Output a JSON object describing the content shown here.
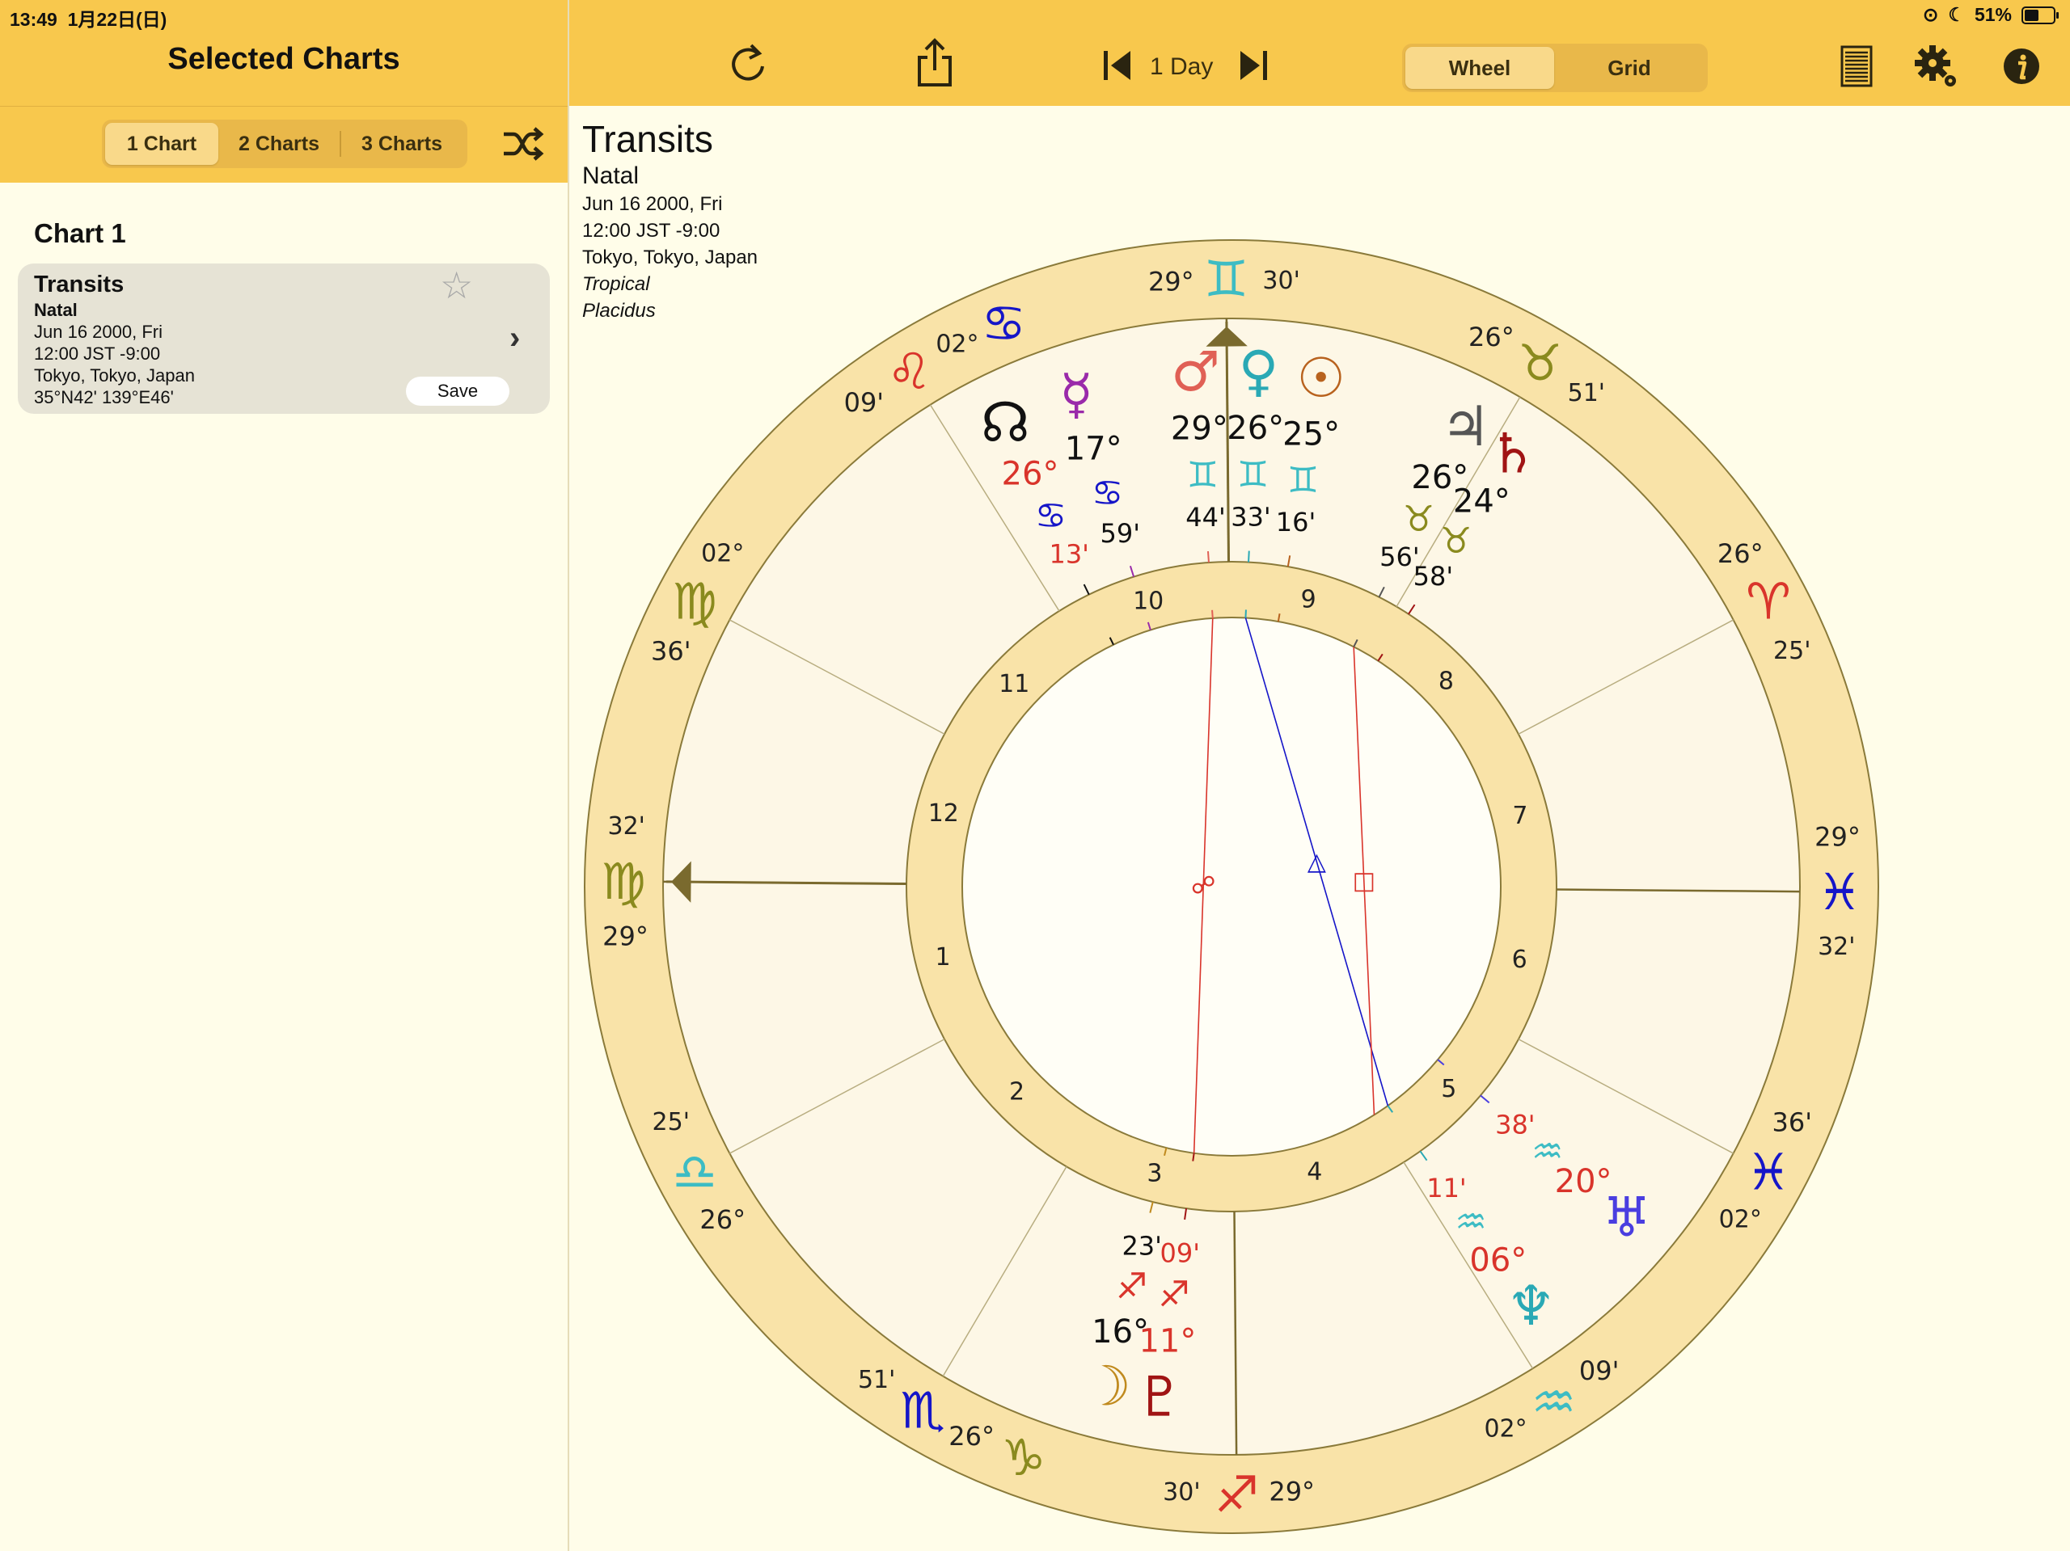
{
  "status": {
    "time": "13:49",
    "date": "1月22日(日)",
    "battery": "51%"
  },
  "sidebar": {
    "title": "Selected Charts",
    "tabs": [
      {
        "label": "1 Chart"
      },
      {
        "label": "2 Charts"
      },
      {
        "label": "3 Charts"
      }
    ],
    "chart_heading": "Chart 1",
    "card": {
      "title": "Transits",
      "subtitle": "Natal",
      "date": "Jun 16 2000, Fri",
      "time": "12:00 JST -9:00",
      "place": "Tokyo, Tokyo, Japan",
      "coords": "35°N42' 139°E46'",
      "save_label": "Save"
    }
  },
  "toolbar": {
    "step_label": "1 Day",
    "view_tabs": [
      {
        "label": "Wheel"
      },
      {
        "label": "Grid"
      }
    ]
  },
  "chart_info": {
    "title": "Transits",
    "subtitle": "Natal",
    "date": "Jun 16 2000, Fri",
    "time": "12:00 JST -9:00",
    "place": "Tokyo, Tokyo, Japan",
    "zodiac": "Tropical",
    "houses": "Placidus"
  },
  "colors": {
    "accent": "#f8c84d",
    "ring": "#f9e3a8",
    "ring_stroke": "#8a7a3a",
    "red": "#d9342b",
    "blue": "#1515c8"
  },
  "chart_data": {
    "type": "wheel",
    "ascendant_deg": 179.5,
    "house_numbers": [
      1,
      2,
      3,
      4,
      5,
      6,
      7,
      8,
      9,
      10,
      11,
      12
    ],
    "house_cusps": [
      {
        "deg": 179.5
      },
      {
        "deg": 208.0
      },
      {
        "deg": 239.5
      },
      {
        "deg": 270.5
      },
      {
        "deg": 302.0
      },
      {
        "deg": 332.0
      },
      {
        "deg": 359.5
      },
      {
        "deg": 28.0
      },
      {
        "deg": 59.5
      },
      {
        "deg": 90.5
      },
      {
        "deg": 122.0
      },
      {
        "deg": 152.0
      }
    ],
    "cusp_labels": [
      {
        "deg": 90.5,
        "sign": "♊",
        "deg_text": "29°",
        "min_text": "30'",
        "color": "#3dbcc4"
      },
      {
        "deg": 59.5,
        "sign": "♉",
        "deg_text": "26°",
        "min_text": "51'",
        "color": "#8a8a1e"
      },
      {
        "deg": 28.0,
        "sign": "♈",
        "deg_text": "26°",
        "min_text": "25'",
        "color": "#d9342b"
      },
      {
        "deg": 359.5,
        "sign": "♓",
        "deg_text": "29°",
        "min_text": "32'",
        "color": "#1515c8"
      },
      {
        "deg": 332.0,
        "sign": "♓",
        "deg_text": "36'",
        "min_text": "02°",
        "color": "#1515c8"
      },
      {
        "deg": 302.0,
        "sign": "♒",
        "deg_text": "09'",
        "min_text": "02°",
        "color": "#3dbcc4"
      },
      {
        "deg": 270.5,
        "sign": "♐",
        "deg_text": "29°",
        "min_text": "30'",
        "color": "#d9342b"
      },
      {
        "deg": 239.5,
        "sign": "♏",
        "deg_text": "26°",
        "min_text": "51'",
        "color": "#1515c8"
      },
      {
        "deg": 208.0,
        "sign": "♎",
        "deg_text": "26°",
        "min_text": "25'",
        "color": "#3dbcc4"
      },
      {
        "deg": 179.5,
        "sign": "♍",
        "deg_text": "29°",
        "min_text": "32'",
        "color": "#8a8a1e"
      },
      {
        "deg": 152.0,
        "sign": "♍",
        "deg_text": "36'",
        "min_text": "02°",
        "color": "#8a8a1e"
      },
      {
        "deg": 122.0,
        "sign": "♌",
        "deg_text": "09'",
        "min_text": "02°",
        "color": "#d9342b"
      }
    ],
    "extra_signs": [
      {
        "deg": 112.0,
        "sign": "♋",
        "color": "#1515c8"
      },
      {
        "deg": 250.0,
        "sign": "♑",
        "color": "#8a8a1e"
      }
    ],
    "planets": [
      {
        "name": "Mars",
        "glyph": "♂",
        "color": "#e06055",
        "deg": 94.0,
        "degree": "29°",
        "sign": "♊",
        "sign_color": "#3dbcc4",
        "minutes": "44'",
        "min_color": "#111"
      },
      {
        "name": "Venus",
        "glyph": "♀",
        "color": "#2aa9b5",
        "deg": 87.0,
        "degree": "26°",
        "sign": "♊",
        "sign_color": "#3dbcc4",
        "minutes": "33'",
        "min_color": "#111"
      },
      {
        "name": "Sun",
        "glyph": "☉",
        "color": "#b8621e",
        "deg": 80.0,
        "degree": "25°",
        "sign": "♊",
        "sign_color": "#3dbcc4",
        "minutes": "16'",
        "min_color": "#111"
      },
      {
        "name": "Mercury",
        "glyph": "☿",
        "color": "#9a2aaa",
        "deg": 107.5,
        "degree": "17°",
        "degree_color": "#111",
        "sign": "♋",
        "sign_color": "#1515c8",
        "minutes": "59'",
        "min_color": "#111"
      },
      {
        "name": "North Node",
        "glyph": "☊",
        "color": "#111",
        "deg": 116.0,
        "degree": "26°",
        "degree_color": "#d9342b",
        "sign": "♋",
        "sign_color": "#1515c8",
        "minutes": "13'",
        "min_color": "#d9342b"
      },
      {
        "name": "Jupiter",
        "glyph": "♃",
        "color": "#555",
        "deg": 63.0,
        "degree": "26°",
        "sign": "♉",
        "sign_color": "#8a8a1e",
        "minutes": "56'",
        "min_color": "#111"
      },
      {
        "name": "Saturn",
        "glyph": "♄",
        "color": "#a01414",
        "deg": 57.0,
        "degree": "24°",
        "sign": "♉",
        "sign_color": "#8a8a1e",
        "minutes": "58'",
        "min_color": "#111"
      },
      {
        "name": "Uranus",
        "glyph": "♅",
        "color": "#4a3ee0",
        "deg": 320.0,
        "degree": "20°",
        "degree_color": "#d9342b",
        "sign": "♒",
        "sign_color": "#3dbcc4",
        "minutes": "38'",
        "min_color": "#d9342b"
      },
      {
        "name": "Neptune",
        "glyph": "♆",
        "color": "#2aa9b5",
        "deg": 305.5,
        "degree": "06°",
        "degree_color": "#d9342b",
        "sign": "♒",
        "sign_color": "#3dbcc4",
        "minutes": "11'",
        "min_color": "#d9342b"
      },
      {
        "name": "Moon",
        "glyph": "☽",
        "color": "#c08a1e",
        "deg": 256.0,
        "degree": "16°",
        "sign": "♐",
        "sign_color": "#d9342b",
        "minutes": "23'",
        "min_color": "#111"
      },
      {
        "name": "Pluto",
        "glyph": "♇",
        "color": "#a01414",
        "deg": 262.0,
        "degree": "11°",
        "degree_color": "#d9342b",
        "sign": "♐",
        "sign_color": "#d9342b",
        "minutes": "09'",
        "min_color": "#d9342b"
      }
    ],
    "aspects": [
      {
        "from": 94.0,
        "to": 262.0,
        "color": "#d9342b",
        "symbol": "☍"
      },
      {
        "from": 87.0,
        "to": 305.5,
        "color": "#1515c8",
        "symbol": "△"
      },
      {
        "from": 63.0,
        "to": 302.0,
        "color": "#d9342b",
        "symbol": "□"
      }
    ]
  }
}
